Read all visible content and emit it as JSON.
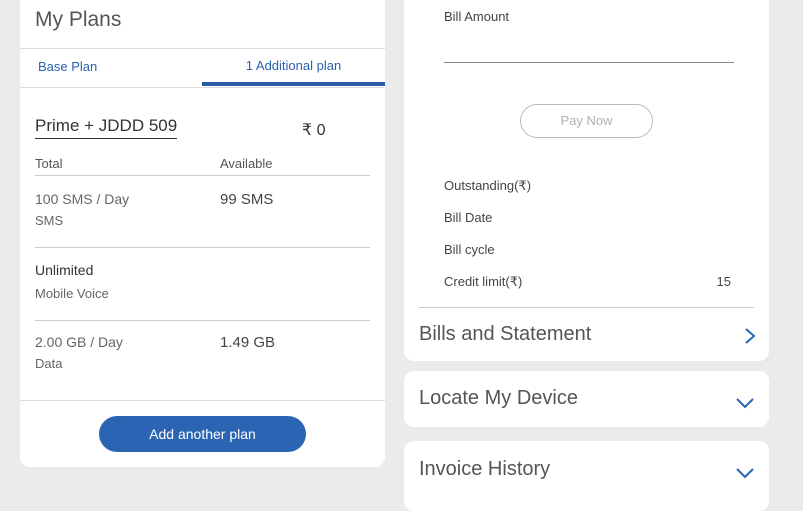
{
  "plans": {
    "title": "My Plans",
    "tabs": [
      {
        "label": "Base Plan",
        "active": false
      },
      {
        "label": "1 Additional plan",
        "active": true
      }
    ],
    "plan_name": "Prime + JDDD 509",
    "price": "₹ 0",
    "columns": {
      "total": "Total",
      "available": "Available"
    },
    "rows": [
      {
        "quantity": "100 SMS / Day",
        "type": "SMS",
        "available": "99 SMS"
      },
      {
        "quantity": "Unlimited",
        "type": "Mobile Voice",
        "available": ""
      },
      {
        "quantity": "2.00 GB / Day",
        "type": "Data",
        "available": "1.49 GB"
      }
    ],
    "add_button": "Add another plan"
  },
  "billing": {
    "amount_label": "Bill Amount",
    "amount_value": "",
    "pay_now": "Pay Now",
    "outstanding": "Outstanding(₹)",
    "bill_date": "Bill Date",
    "bill_cycle": "Bill cycle",
    "credit_limit": "Credit limit(₹)",
    "credit_limit_value": "15",
    "bills_statement": "Bills and Statement"
  },
  "sections": {
    "locate_device": "Locate My Device",
    "invoice_history": "Invoice History"
  },
  "icons": {
    "bills_arrow": "chevron-right-icon",
    "locate_arrow": "chevron-down-icon",
    "invoice_arrow": "chevron-down-icon"
  },
  "colors": {
    "accent": "#2c64b4",
    "tab_text": "#2b5fb2",
    "background": "#ebebeb"
  }
}
